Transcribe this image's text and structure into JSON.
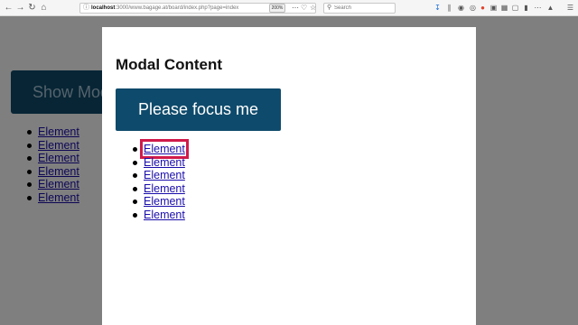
{
  "browser": {
    "url_host": "localhost",
    "url_rest": ":3000/www.bagage.at/board/index.php?page=index",
    "zoom": "200%",
    "search_placeholder": "Search"
  },
  "page": {
    "show_modal_label": "Show Modal",
    "links": [
      "Element",
      "Element",
      "Element",
      "Element",
      "Element",
      "Element"
    ]
  },
  "modal": {
    "title": "Modal Content",
    "focus_button_label": "Please focus me",
    "links": [
      "Element",
      "Element",
      "Element",
      "Element",
      "Element",
      "Element"
    ],
    "focused_index": 0,
    "focus_ring_color": "#d11a4a",
    "button_color": "#0e4a6b",
    "overlay_color": "rgba(0,0,0,0.5)"
  }
}
